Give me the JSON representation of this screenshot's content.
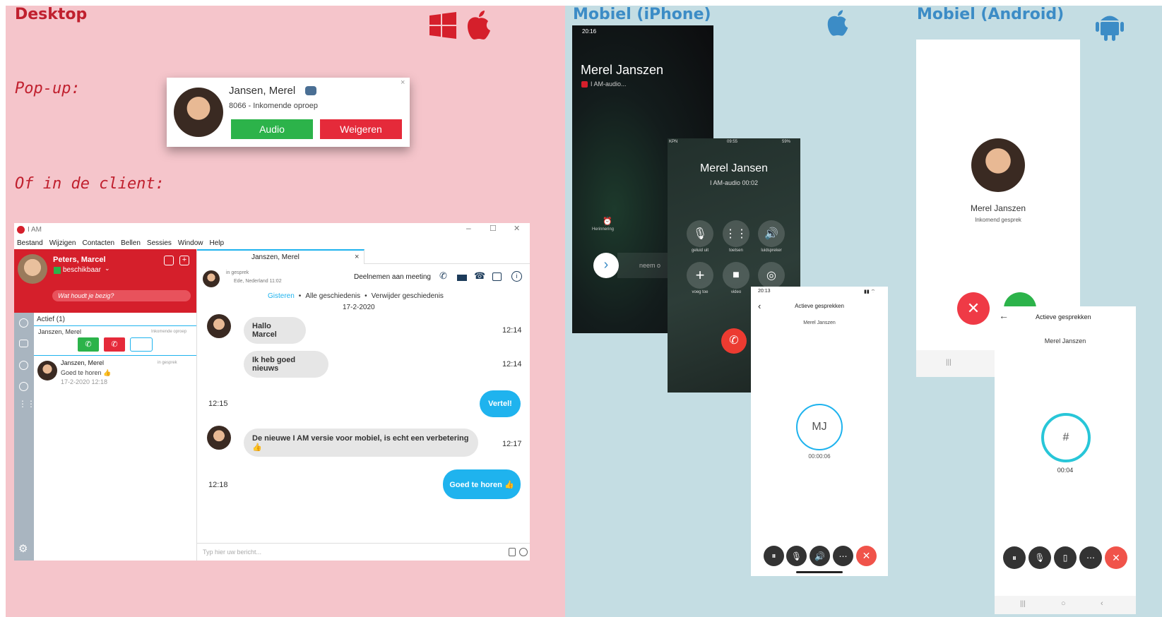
{
  "desktop": {
    "title": "Desktop",
    "popup_label": "Pop-up:",
    "client_label": "Of in de client:",
    "popup": {
      "name": "Jansen, Merel",
      "subtitle": "8066 - Inkomende oproep",
      "accept": "Audio",
      "decline": "Weigeren",
      "close": "×"
    },
    "client": {
      "app_title": "I AM",
      "win_min": "–",
      "win_max": "☐",
      "win_close": "✕",
      "menu": [
        "Bestand",
        "Wijzigen",
        "Contacten",
        "Bellen",
        "Sessies",
        "Window",
        "Help"
      ],
      "user_name": "Peters, Marcel",
      "user_status": "beschikbaar",
      "status_prompt": "Wat houdt je bezig?",
      "active_header": "Actief (1)",
      "active_item_name": "Janszen, Merel",
      "active_item_status": "Inkomende oproep",
      "history_name": "Janszen, Merel",
      "history_status": "in gesprek",
      "history_msg": "Goed te horen 👍",
      "history_date": "17-2-2020 12:18",
      "tab_title": "Janszen, Merel",
      "tab_close": "×",
      "contact_status": "in gesprek",
      "contact_location": "Ede, Nederland 11:02",
      "join_meeting": "Deelnemen aan meeting",
      "history_links": [
        "Gisteren",
        "•",
        "Alle geschiedenis",
        "•",
        "Verwijder geschiedenis"
      ],
      "day": "17-2-2020",
      "messages": [
        {
          "text": "Hallo Marcel",
          "time": "12:14",
          "from": "them"
        },
        {
          "text": "Ik heb goed nieuws",
          "time": "12:14",
          "from": "them"
        },
        {
          "text": "Vertel!",
          "time": "12:15",
          "from": "me"
        },
        {
          "text": "De nieuwe I AM versie voor mobiel, is echt een verbetering 👍",
          "time": "12:17",
          "from": "them"
        },
        {
          "text": "Goed te horen 👍",
          "time": "12:18",
          "from": "me"
        }
      ],
      "input_placeholder": "Typ hier uw bericht..."
    }
  },
  "iphone": {
    "title": "Mobiel  (iPhone)",
    "lock": {
      "time": "20:16",
      "caller": "Merel Janszen",
      "app": "I AM-audio...",
      "reminder": "Herinnering",
      "slide": "neem o"
    },
    "call": {
      "status_left": "KPN",
      "status_time": "09:55",
      "status_right": "59%",
      "caller": "Merel Jansen",
      "app": "I AM-audio 00:02",
      "buttons": [
        "geluid uit",
        "toetsen",
        "luidspreker",
        "voeg toe",
        "video",
        ""
      ]
    },
    "active": {
      "time": "20:13",
      "title": "Actieve gesprekken",
      "item": "Merel Janszen",
      "initials": "MJ",
      "timer": "00:00:06"
    }
  },
  "android": {
    "title": "Mobiel (Android)",
    "incoming": {
      "name": "Merel Janszen",
      "status": "Inkomend gesprek"
    },
    "active": {
      "title": "Actieve gesprekken",
      "item": "Merel Janszen",
      "keypad": "#",
      "timer": "00:04"
    }
  },
  "colors": {
    "desktop_bg": "#f5c5cb",
    "mobile_bg": "#c4dde3",
    "brand_red": "#d51f2b",
    "accept_green": "#2cb34a",
    "chat_blue": "#1fb3ee"
  }
}
